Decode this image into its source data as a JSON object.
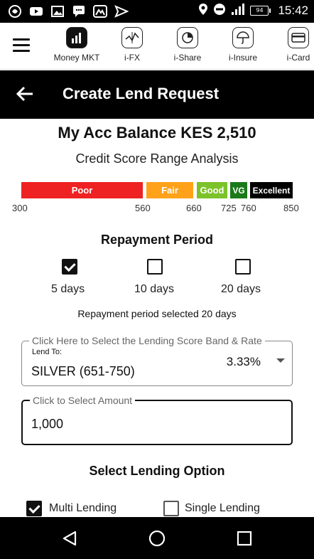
{
  "status_bar": {
    "battery": "94",
    "time": "15:42"
  },
  "nav": {
    "items": [
      {
        "label": "Money MKT",
        "icon": "money-market-icon"
      },
      {
        "label": "i-FX",
        "icon": "fx-chart-icon"
      },
      {
        "label": "i-Share",
        "icon": "share-chart-icon"
      },
      {
        "label": "i-Insure",
        "icon": "umbrella-icon"
      },
      {
        "label": "i-Card",
        "icon": "card-icon"
      }
    ]
  },
  "header": {
    "title": "Create Lend Request"
  },
  "balance": "My Acc Balance KES 2,510",
  "credit_title": "Credit Score Range Analysis",
  "score_bands": [
    {
      "label": "Poor",
      "color": "#ee2222"
    },
    {
      "label": "Fair",
      "color": "#ffa21a"
    },
    {
      "label": "Good",
      "color": "#7cc22a"
    },
    {
      "label": "VG",
      "color": "#1a7a1a"
    },
    {
      "label": "Excellent",
      "color": "#000000"
    }
  ],
  "score_ticks": [
    "300",
    "560",
    "660",
    "725",
    "760",
    "850"
  ],
  "repayment": {
    "title": "Repayment Period",
    "options": [
      {
        "label": "5 days",
        "checked": true
      },
      {
        "label": "10 days",
        "checked": false
      },
      {
        "label": "20 days",
        "checked": false
      }
    ],
    "selected_note": "Repayment period selected 20 days"
  },
  "band_select": {
    "legend": "Click Here to Select the Lending Score Band & Rate",
    "lend_to": "Lend To:",
    "band": "SILVER (651-750)",
    "rate": "3.33%"
  },
  "amount": {
    "legend": "Click to Select Amount",
    "value": "1,000"
  },
  "lending_option": {
    "title": "Select Lending Option",
    "options": [
      {
        "label": "Multi Lending",
        "checked": true
      },
      {
        "label": "Single Lending",
        "checked": false
      }
    ]
  }
}
